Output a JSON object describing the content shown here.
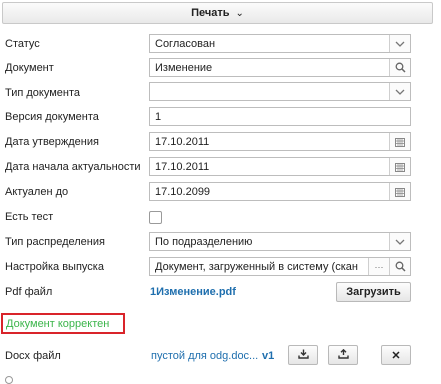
{
  "toolbar": {
    "print_label": "Печать",
    "chevron": "⌄"
  },
  "form": {
    "status": {
      "label": "Статус",
      "value": "Согласован"
    },
    "document": {
      "label": "Документ",
      "value": "Изменение"
    },
    "doc_type": {
      "label": "Тип документа",
      "value": ""
    },
    "version": {
      "label": "Версия документа",
      "value": "1"
    },
    "approval_date": {
      "label": "Дата утверждения",
      "value": "17.10.2011"
    },
    "actual_start": {
      "label": "Дата начала актуальности",
      "value": "17.10.2011"
    },
    "actual_until": {
      "label": "Актуален до",
      "value": "17.10.2099"
    },
    "has_test": {
      "label": "Есть тест",
      "checked": false
    },
    "distribution_type": {
      "label": "Тип распределения",
      "value": "По подразделению"
    },
    "release_setting": {
      "label": "Настройка выпуска",
      "value": "Документ, загруженный в систему (скан",
      "more": "···"
    },
    "pdf_file": {
      "label": "Pdf файл",
      "link": "1Изменение.pdf",
      "upload_button": "Загрузить"
    },
    "status_message": "Документ корректен",
    "docx_file": {
      "label": "Docx файл",
      "link": "пустой для odg.doc...",
      "version": "v1",
      "close": "✕"
    }
  },
  "icons": [
    "chevron-down-icon",
    "search-icon",
    "calendar-icon",
    "ellipsis-icon",
    "download-icon",
    "upload-icon",
    "close-icon"
  ],
  "colors": {
    "link": "#1f6fae",
    "ok_text": "#3bb54a",
    "highlight_border": "#d9242a"
  }
}
